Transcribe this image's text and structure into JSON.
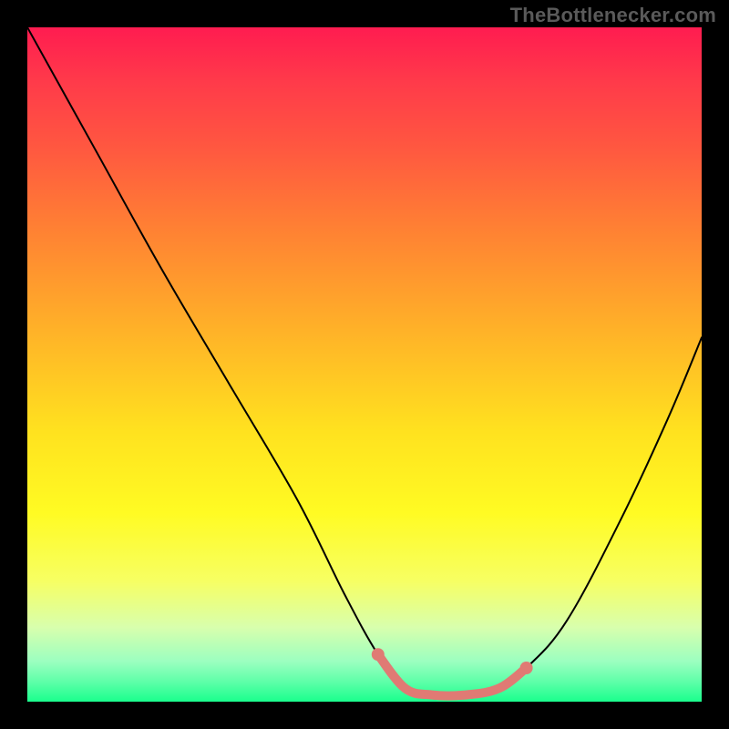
{
  "watermark": "TheBottlenecker.com",
  "chart_data": {
    "type": "line",
    "title": "",
    "xlabel": "",
    "ylabel": "",
    "xlim": [
      0,
      100
    ],
    "ylim": [
      0,
      100
    ],
    "series": [
      {
        "name": "bottleneck-curve",
        "x": [
          0,
          10,
          20,
          30,
          40,
          47,
          52,
          56,
          60,
          65,
          70,
          74,
          80,
          88,
          95,
          100
        ],
        "y": [
          100,
          82,
          64,
          47,
          30,
          16,
          7,
          2,
          1,
          1,
          2,
          5,
          12,
          27,
          42,
          54
        ],
        "stroke": "#000000",
        "stroke_width": 2
      },
      {
        "name": "highlight-segment",
        "x": [
          52,
          56,
          60,
          65,
          70,
          74
        ],
        "y": [
          7,
          2,
          1,
          1,
          2,
          5
        ],
        "stroke": "#e07a74",
        "stroke_width": 10,
        "marker": true
      }
    ],
    "gradient_stops": [
      {
        "pos": 0.0,
        "color": "#ff1c50"
      },
      {
        "pos": 0.3,
        "color": "#ff8133"
      },
      {
        "pos": 0.6,
        "color": "#ffe21f"
      },
      {
        "pos": 0.82,
        "color": "#f7ff62"
      },
      {
        "pos": 1.0,
        "color": "#1aff8d"
      }
    ]
  }
}
